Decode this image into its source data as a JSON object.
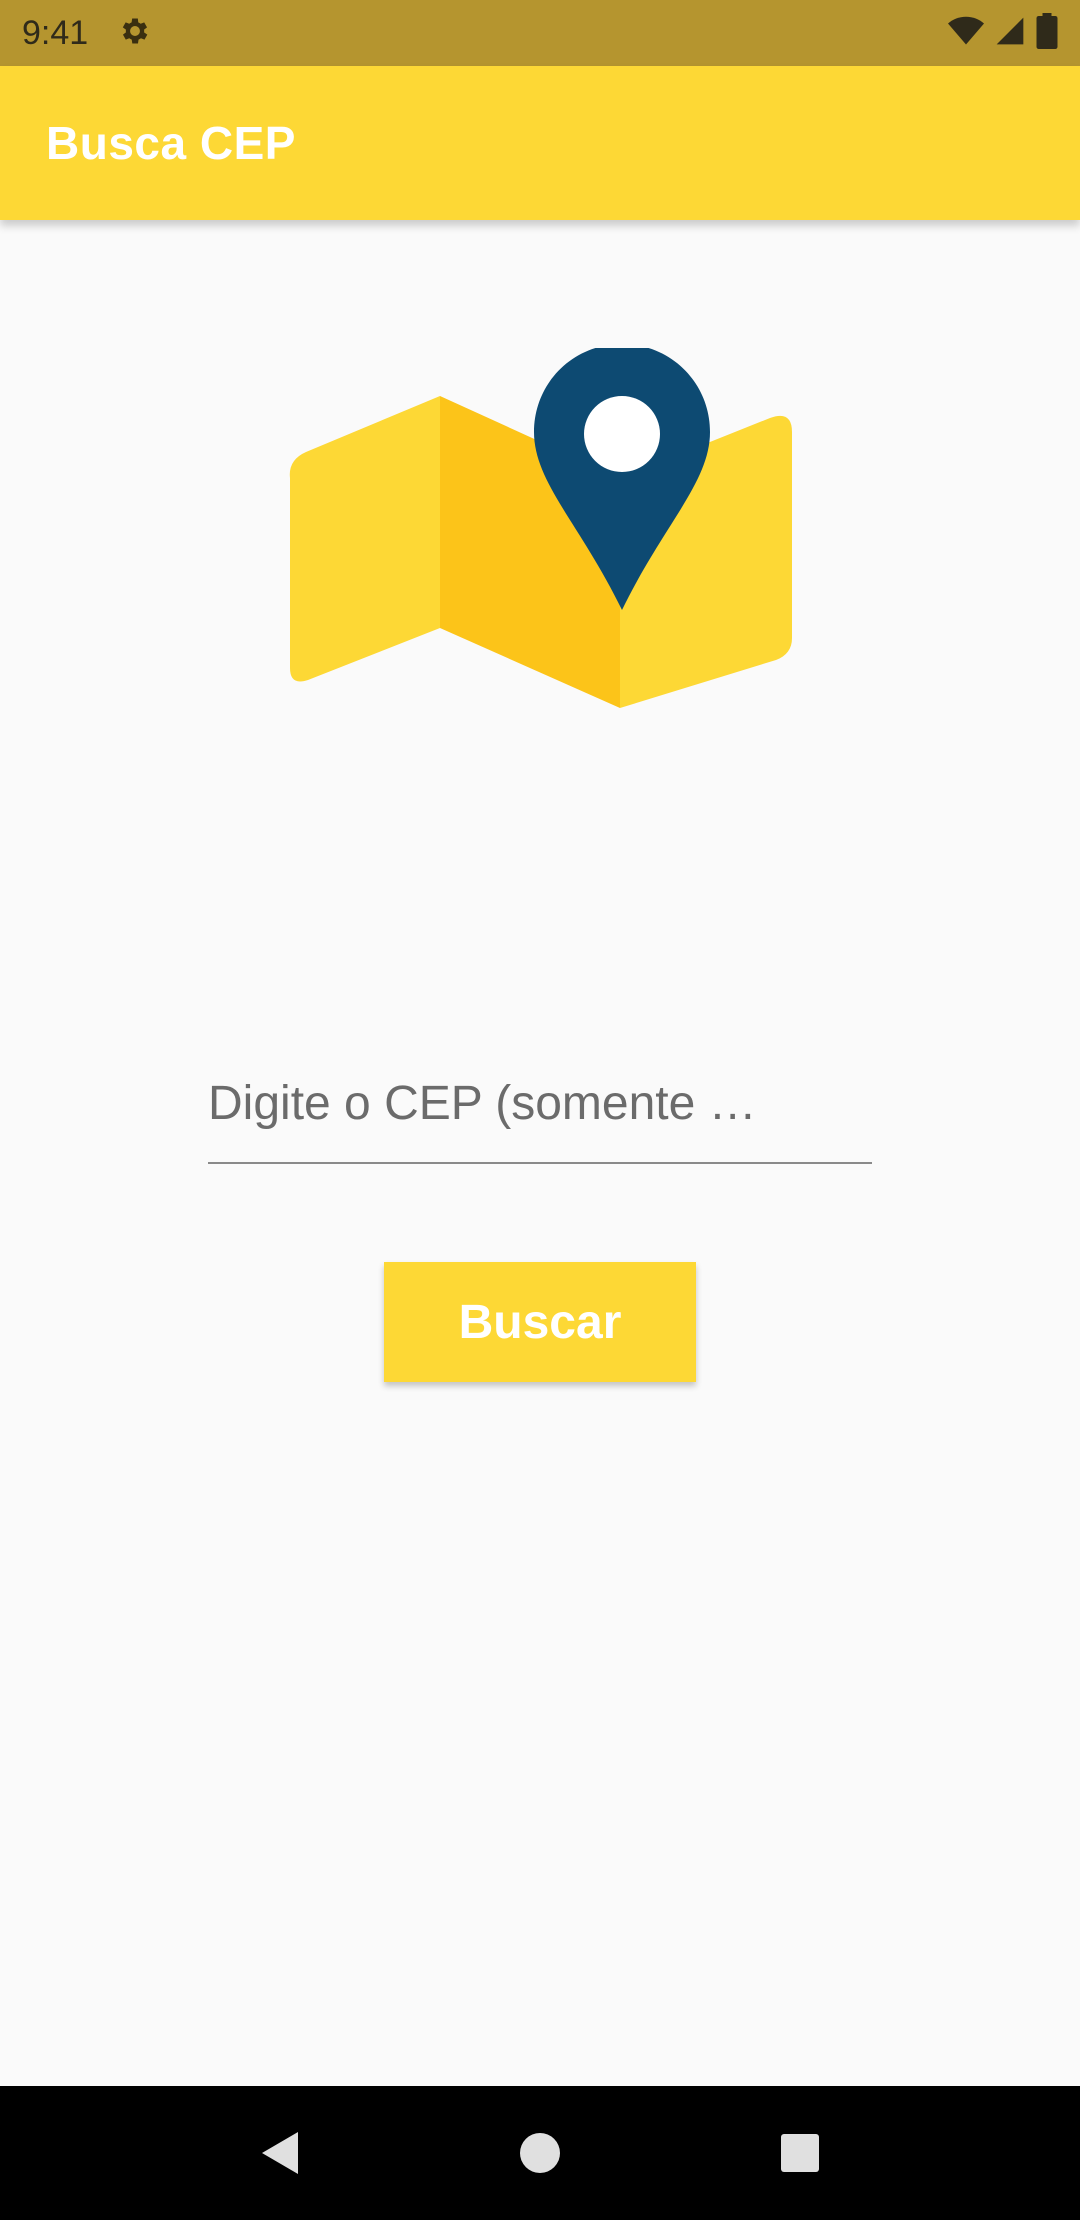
{
  "status_bar": {
    "time": "9:41",
    "icons": [
      "settings-icon",
      "wifi-icon",
      "signal-icon",
      "battery-icon"
    ]
  },
  "app_bar": {
    "title": "Busca CEP",
    "color": "#fdd835"
  },
  "illustration": {
    "icon": "map-pin-icon",
    "map_color": "#fdd835",
    "pin_color": "#0d4a72"
  },
  "cep_field": {
    "placeholder": "Digite o CEP (somente …",
    "value": ""
  },
  "search_button": {
    "label": "Buscar"
  },
  "nav_bar": {
    "items": [
      "back-icon",
      "home-icon",
      "recents-icon"
    ]
  }
}
